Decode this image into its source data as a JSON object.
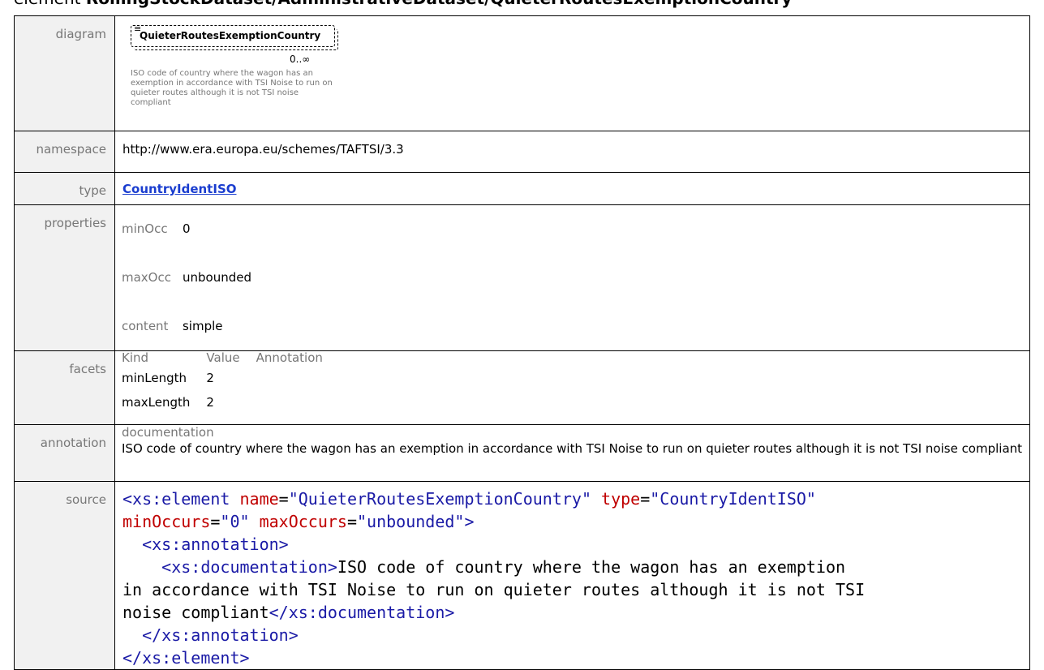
{
  "title": {
    "prefix": "element",
    "path": "RollingStockDataset/AdministrativeDataset/QuieterRoutesExemptionCountry"
  },
  "labels": {
    "diagram": "diagram",
    "namespace": "namespace",
    "type": "type",
    "properties": "properties",
    "facets": "facets",
    "annotation": "annotation",
    "source": "source"
  },
  "diagram": {
    "element_name": "QuieterRoutesExemptionCountry",
    "glyph": "≡",
    "occurrence": "0..∞",
    "note": "ISO code of country where the wagon has an exemption in accordance with TSI Noise to run on quieter routes although it is not TSI noise compliant"
  },
  "namespace": "http://www.era.europa.eu/schemes/TAFTSI/3.3",
  "type": "CountryIdentISO",
  "properties": [
    {
      "key": "minOcc",
      "value": "0"
    },
    {
      "key": "maxOcc",
      "value": "unbounded"
    },
    {
      "key": "content",
      "value": "simple"
    }
  ],
  "facets": {
    "headers": [
      "Kind",
      "Value",
      "Annotation"
    ],
    "rows": [
      {
        "kind": "minLength",
        "value": "2",
        "annotation": ""
      },
      {
        "kind": "maxLength",
        "value": "2",
        "annotation": ""
      }
    ]
  },
  "annotation": {
    "head": "documentation",
    "text": "ISO code of country where the wagon has an exemption in accordance with TSI Noise to run on quieter routes although it is not TSI noise compliant"
  },
  "source": {
    "el_open": "<xs:element",
    "attr_name": "name",
    "val_name": "\"QuieterRoutesExemptionCountry\"",
    "attr_type": "type",
    "val_type": "\"CountryIdentISO\"",
    "attr_min": "minOccurs",
    "val_min": "\"0\"",
    "attr_max": "maxOccurs",
    "val_max": "\"unbounded\"",
    "gt": ">",
    "ann_open": "<xs:annotation>",
    "doc_open": "<xs:documentation>",
    "doc_text_1": "ISO code of country where the wagon has an exemption",
    "doc_text_2": "in accordance with TSI Noise to run on quieter routes although it is not TSI",
    "doc_text_3": "noise compliant",
    "doc_close": "</xs:documentation>",
    "ann_close": "</xs:annotation>",
    "el_close": "</xs:element>"
  }
}
